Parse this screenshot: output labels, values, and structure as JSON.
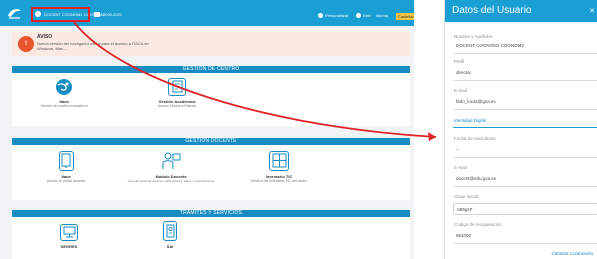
{
  "topbar": {
    "user_label": "DOCENT COGNOM1 COGNOM2",
    "year_label": "2020-2021",
    "right_items": [
      {
        "label": "Personalitzar",
        "icon": "settings-icon"
      },
      {
        "label": "Eixir",
        "icon": "power-icon"
      },
      {
        "label": "Idioma",
        "icon": "language-icon"
      }
    ],
    "menu_label": "Castellano"
  },
  "notice": {
    "badge": "!",
    "title": "AVISO",
    "body": "Nueva versión del navegador oficial para el acceso a ITACA en Windows, Mac ..."
  },
  "sections": [
    {
      "title": "GESTIÓN DE CENTRO",
      "tiles": [
        {
          "title": "Itaca",
          "subtitle": "Gestión de centros educativos",
          "icon": "globe-icon"
        },
        {
          "title": "Gestión Académica",
          "subtitle": "Acceso Módulos Diferido",
          "icon": "document-icon"
        }
      ]
    },
    {
      "title": "GESTIÓN DOCENTE",
      "tiles": [
        {
          "title": "Itaca",
          "subtitle": "Acceso al portal docente",
          "icon": "mobile-icon"
        },
        {
          "title": "Módulo Docente",
          "subtitle": "Área del personal docente: calificaciones, faltas, comunicaciones",
          "icon": "teacher-icon"
        },
        {
          "title": "Inventario TIC",
          "subtitle": "Gestión del inventario TIC del centro",
          "icon": "inventory-icon"
        }
      ]
    },
    {
      "title": "TRÁMITES Y SERVICIOS",
      "tiles": [
        {
          "title": "SEGRES",
          "subtitle": "",
          "icon": "monitor-icon"
        },
        {
          "title": "SAI",
          "subtitle": "",
          "icon": "badge-icon"
        }
      ]
    }
  ],
  "panel": {
    "title": "Datos del Usuario",
    "close": "✕",
    "fields": [
      {
        "label": "Nombre y Apellidos",
        "value": "DOCENT COGNOM1 COGNOM2"
      },
      {
        "label": "Perfil",
        "value": "director"
      },
      {
        "label": "E-mail",
        "value": "fedo_lucas@gva.es"
      }
    ],
    "identity_link": "Identidad Digital",
    "fields2": [
      {
        "label": "Fecha de nacimiento",
        "value": "--"
      },
      {
        "label": "E-mail",
        "value": "docent@edu.gva.es"
      }
    ],
    "password_label": "Clave inicial",
    "password_value": "nB5gH*",
    "recovery_label": "Código de recuperación",
    "recovery_value": "681000",
    "footer_link": "Cambiar Contraseña"
  },
  "colors": {
    "accent": "#1a9fd4",
    "section_header": "#1a8cc4",
    "highlight": "#e12327",
    "notice_bg": "#fbe9e2",
    "notice_badge": "#e9562e"
  }
}
